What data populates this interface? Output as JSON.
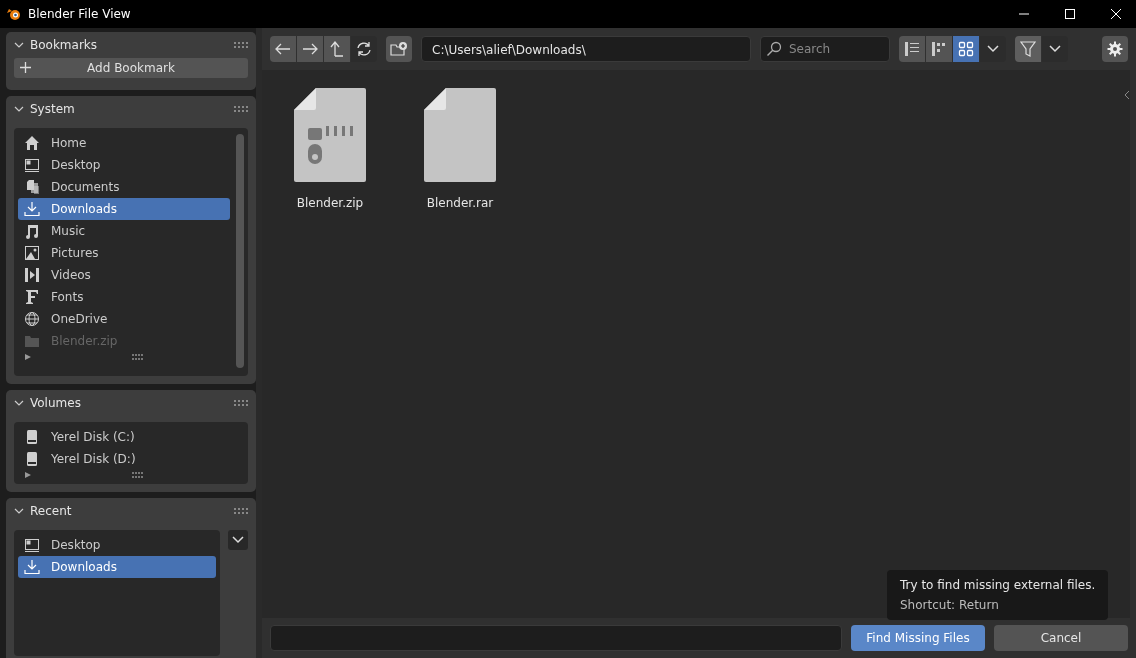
{
  "window": {
    "title": "Blender File View"
  },
  "sidebar": {
    "panels": [
      {
        "kind": "bookmarks",
        "title": "Bookmarks",
        "expanded": true,
        "button": "Add Bookmark"
      },
      {
        "kind": "system",
        "title": "System",
        "expanded": true,
        "items": [
          {
            "kind": "home",
            "label": "Home",
            "selected": false,
            "disabled": false
          },
          {
            "kind": "desktop",
            "label": "Desktop",
            "selected": false,
            "disabled": false
          },
          {
            "kind": "documents",
            "label": "Documents",
            "selected": false,
            "disabled": false
          },
          {
            "kind": "downloads",
            "label": "Downloads",
            "selected": true,
            "disabled": false
          },
          {
            "kind": "music",
            "label": "Music",
            "selected": false,
            "disabled": false
          },
          {
            "kind": "pictures",
            "label": "Pictures",
            "selected": false,
            "disabled": false
          },
          {
            "kind": "videos",
            "label": "Videos",
            "selected": false,
            "disabled": false
          },
          {
            "kind": "fonts",
            "label": "Fonts",
            "selected": false,
            "disabled": false
          },
          {
            "kind": "globe",
            "label": "OneDrive",
            "selected": false,
            "disabled": false
          },
          {
            "kind": "folder",
            "label": "Blender.zip",
            "selected": false,
            "disabled": true
          }
        ]
      },
      {
        "kind": "volumes",
        "title": "Volumes",
        "expanded": true,
        "items": [
          {
            "kind": "disk",
            "label": "Yerel Disk (C:)",
            "selected": false,
            "disabled": false
          },
          {
            "kind": "disk",
            "label": "Yerel Disk (D:)",
            "selected": false,
            "disabled": false
          }
        ]
      },
      {
        "kind": "recent",
        "title": "Recent",
        "expanded": true,
        "items": [
          {
            "kind": "desktop",
            "label": "Desktop",
            "selected": false,
            "disabled": false
          },
          {
            "kind": "downloads",
            "label": "Downloads",
            "selected": true,
            "disabled": false
          }
        ]
      }
    ]
  },
  "toolbar": {
    "path": "C:\\Users\\alief\\Downloads\\",
    "search": {
      "placeholder": "Search"
    },
    "view_modes": [
      {
        "kind": "vertical",
        "selected": false
      },
      {
        "kind": "horizontal",
        "selected": false
      },
      {
        "kind": "thumbnails",
        "selected": true
      }
    ]
  },
  "files": [
    {
      "kind": "zip",
      "name": "Blender.zip"
    },
    {
      "kind": "file",
      "name": "Blender.rar"
    }
  ],
  "footer": {
    "confirm": "Find Missing Files",
    "cancel": "Cancel"
  },
  "tooltip": {
    "text": "Try to find missing external files.",
    "shortcut": "Shortcut: Return"
  }
}
